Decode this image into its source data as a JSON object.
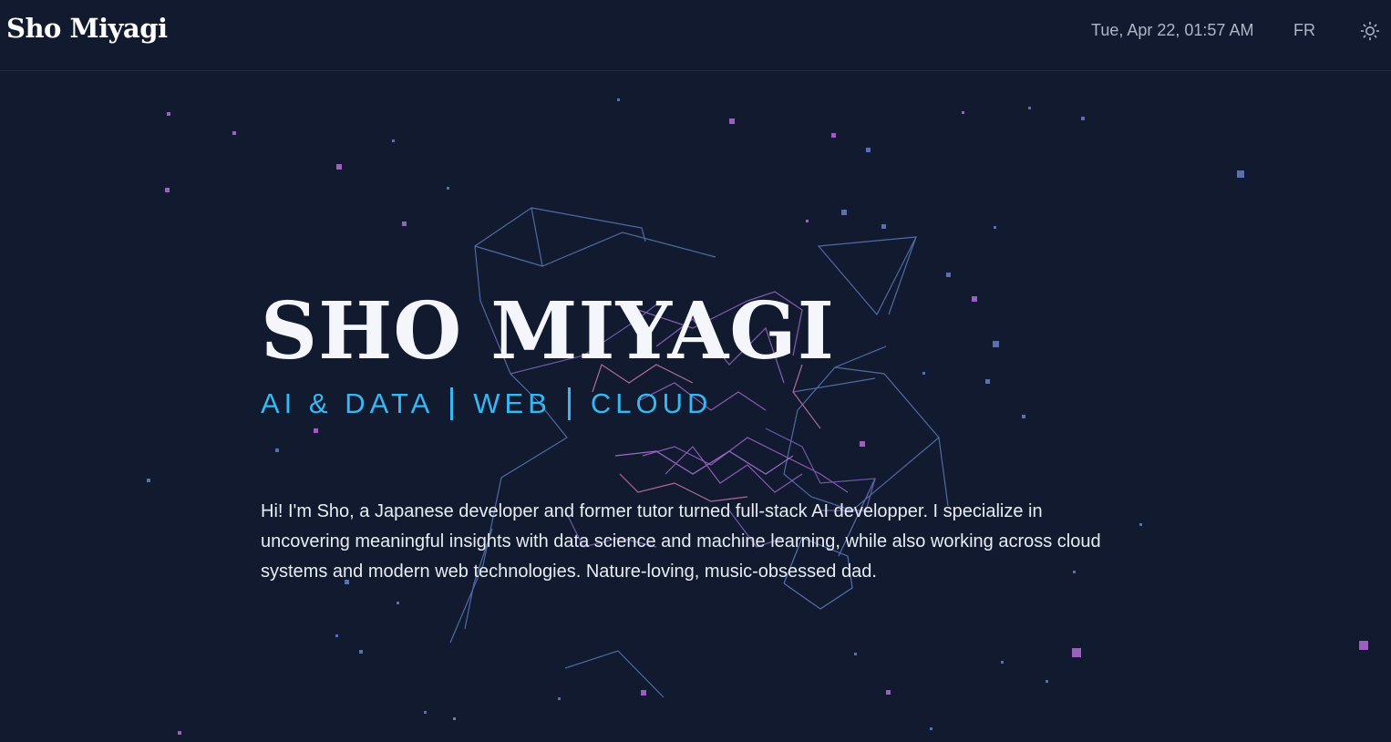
{
  "header": {
    "brand": "Sho Miyagi",
    "datetime": "Tue, Apr 22, 01:57 AM",
    "language_toggle": "FR",
    "theme_icon": "sun-icon"
  },
  "hero": {
    "title": "SHO MIYAGI",
    "subtitle_items": [
      "AI & DATA",
      "WEB",
      "CLOUD"
    ],
    "description": "Hi! I'm Sho, a Japanese developer and former tutor turned full-stack AI developper. I specialize in uncovering meaningful insights with data science and machine learning, while also working across cloud systems and modern web technologies. Nature-loving, music-obsessed dad."
  },
  "colors": {
    "background": "#111a2e",
    "accent": "#38b8f2",
    "network_blue": "#5a6fb0",
    "network_purple": "#9b5fc0",
    "network_pink": "#c06a8a"
  }
}
